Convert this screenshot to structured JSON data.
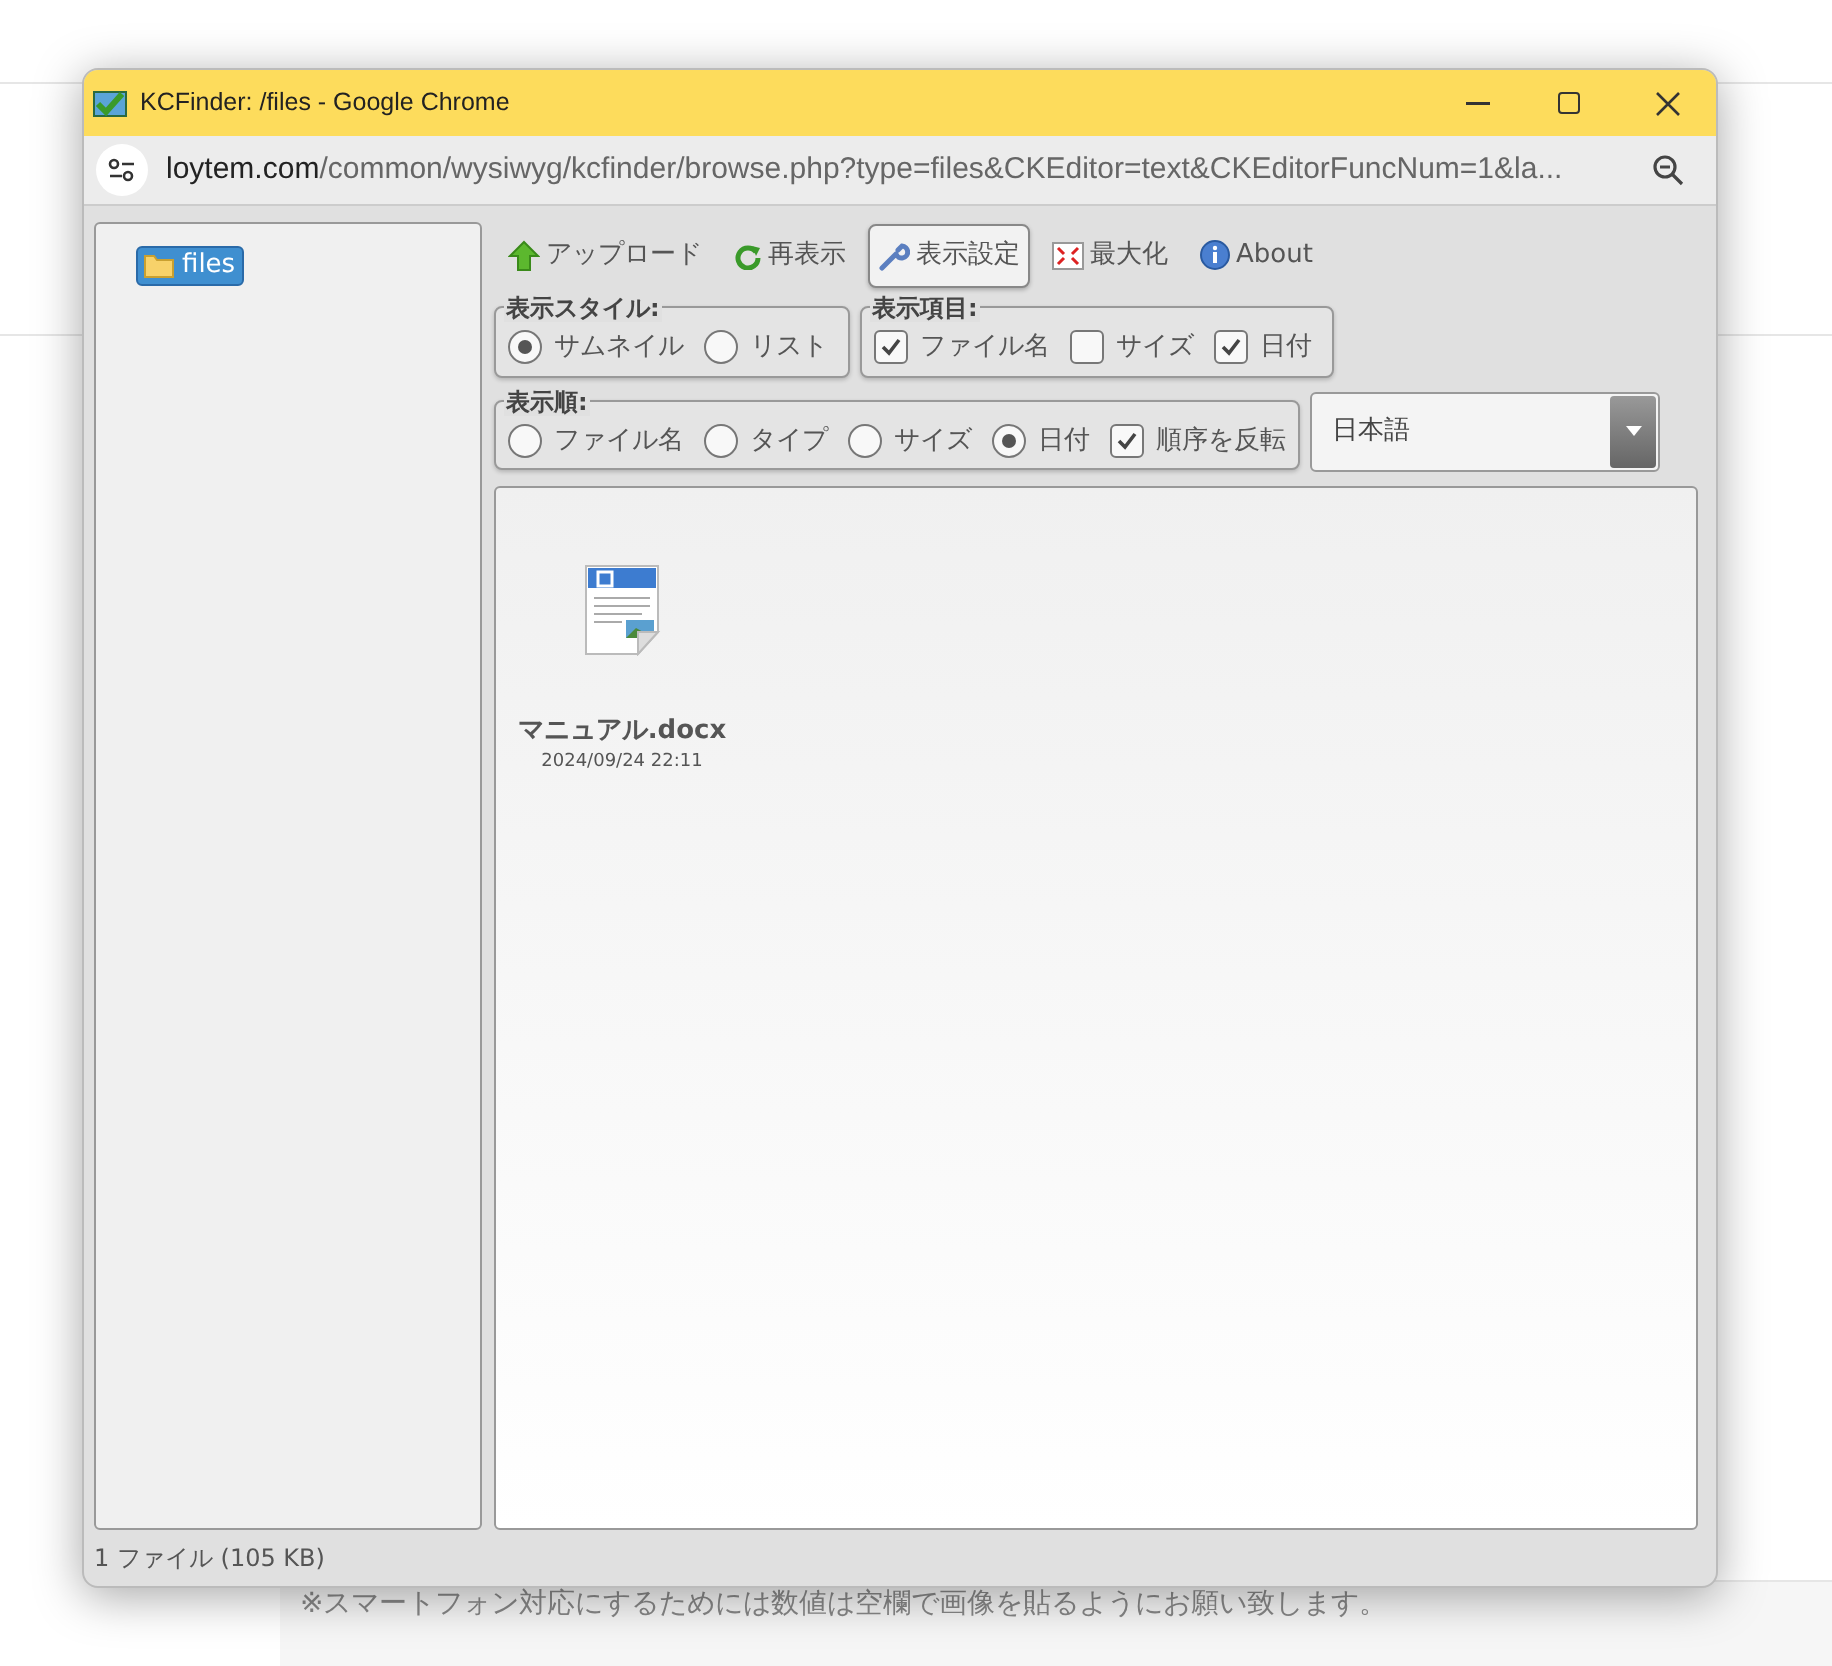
{
  "window": {
    "title": "KCFinder: /files - Google Chrome"
  },
  "address_bar": {
    "host": "loytem.com",
    "path": "/common/wysiwyg/kcfinder/browse.php?type=files&CKEditor=text&CKEditorFuncNum=1&la..."
  },
  "folders": [
    {
      "label": "files",
      "selected": true
    }
  ],
  "toolbar": [
    {
      "kind": "upload",
      "label": "アップロード",
      "selected": false
    },
    {
      "kind": "refresh",
      "label": "再表示",
      "selected": false
    },
    {
      "kind": "settings",
      "label": "表示設定",
      "selected": true
    },
    {
      "kind": "maximize",
      "label": "最大化",
      "selected": false
    },
    {
      "kind": "about",
      "label": "About",
      "selected": false
    }
  ],
  "view_style": {
    "legend": "表示スタイル:",
    "options": [
      {
        "label": "サムネイル",
        "selected": true
      },
      {
        "label": "リスト",
        "selected": false
      }
    ]
  },
  "show_items": {
    "legend": "表示項目:",
    "options": [
      {
        "label": "ファイル名",
        "checked": true
      },
      {
        "label": "サイズ",
        "checked": false
      },
      {
        "label": "日付",
        "checked": true
      }
    ]
  },
  "sort_order": {
    "legend": "表示順:",
    "options": [
      {
        "label": "ファイル名",
        "selected": false
      },
      {
        "label": "タイプ",
        "selected": false
      },
      {
        "label": "サイズ",
        "selected": false
      },
      {
        "label": "日付",
        "selected": true
      }
    ],
    "reverse": {
      "label": "順序を反転",
      "checked": true
    }
  },
  "language": {
    "value": "日本語"
  },
  "files": [
    {
      "name": "マニュアル.docx",
      "date": "2024/09/24 22:11"
    }
  ],
  "status_bar": "1 ファイル (105 KB)",
  "background_text": "※スマートフォン対応にするためには数値は空欄で画像を貼るようにお願い致します。"
}
